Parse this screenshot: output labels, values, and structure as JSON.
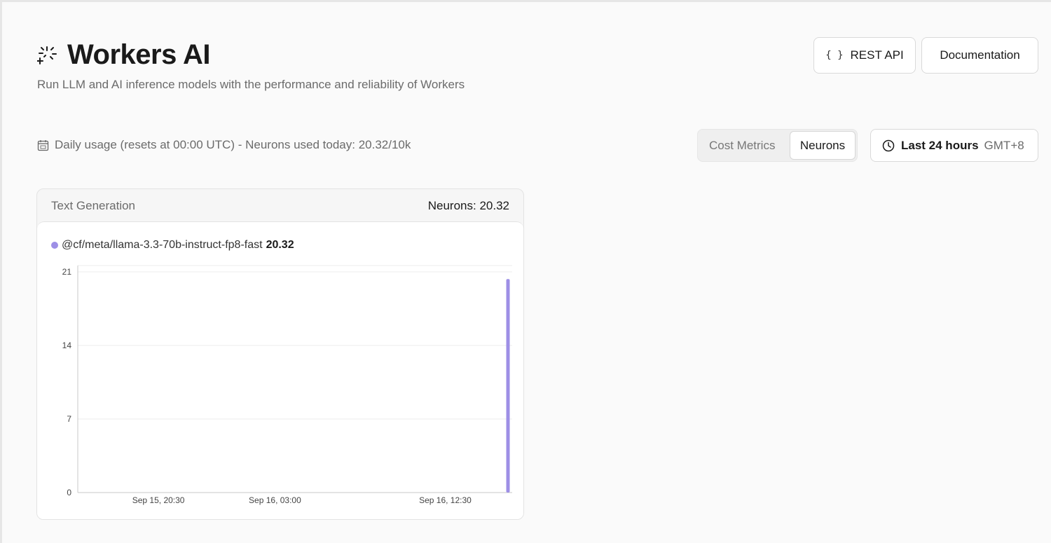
{
  "header": {
    "title": "Workers AI",
    "subtitle": "Run LLM and AI inference models with the performance and reliability of Workers",
    "icon": "sparkle-icon"
  },
  "actions": {
    "rest_api_label": "REST API",
    "rest_api_icon": "braces-icon",
    "braces_glyph": "{ }",
    "documentation_label": "Documentation"
  },
  "usage": {
    "icon": "calendar-icon",
    "text": "Daily usage (resets at 00:00 UTC) - Neurons used today: 20.32/10k"
  },
  "metric_toggle": {
    "options": [
      "Cost Metrics",
      "Neurons"
    ],
    "selected": "Neurons"
  },
  "time_range": {
    "icon": "clock-icon",
    "label": "Last 24 hours",
    "timezone": "GMT+8"
  },
  "card": {
    "title": "Text Generation",
    "metric": "Neurons: 20.32",
    "legend_model": "@cf/meta/llama-3.3-70b-instruct-fp8-fast",
    "legend_value": "20.32"
  },
  "colors": {
    "series": "#9d8fe6",
    "grid": "#ececec",
    "axis": "#c8c8c8"
  },
  "chart_data": {
    "type": "bar",
    "x_ticks": [
      "Sep 15, 20:30",
      "Sep 16, 03:00",
      "Sep 16, 12:30"
    ],
    "y_ticks": [
      0,
      7,
      14,
      21
    ],
    "ylim": [
      0,
      21
    ],
    "series": [
      {
        "name": "@cf/meta/llama-3.3-70b-instruct-fp8-fast",
        "points": [
          {
            "x": "Sep 16, 16:00",
            "y": 20.32
          }
        ]
      }
    ],
    "grid": true
  }
}
